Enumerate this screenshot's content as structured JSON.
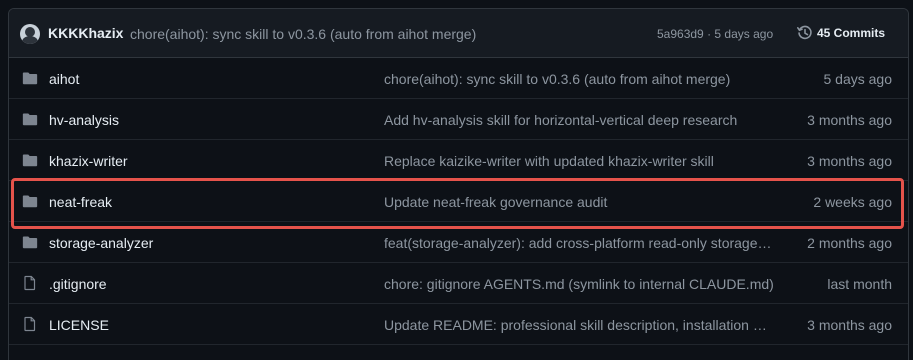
{
  "header": {
    "author": "KKKKhazix",
    "commit_message": "chore(aihot): sync skill to v0.3.6 (auto from aihot merge)",
    "commit_hash": "5a963d9",
    "separator": "·",
    "commit_time": "5 days ago",
    "commits_label": "45 Commits",
    "icons": {
      "avatar": "user-avatar",
      "history": "history-clock-icon"
    }
  },
  "rows": [
    {
      "type": "folder",
      "name": "aihot",
      "message": "chore(aihot): sync skill to v0.3.6 (auto from aihot merge)",
      "date": "5 days ago"
    },
    {
      "type": "folder",
      "name": "hv-analysis",
      "message": "Add hv-analysis skill for horizontal-vertical deep research",
      "date": "3 months ago"
    },
    {
      "type": "folder",
      "name": "khazix-writer",
      "message": "Replace kaizike-writer with updated khazix-writer skill",
      "date": "3 months ago"
    },
    {
      "type": "folder",
      "name": "neat-freak",
      "message": "Update neat-freak governance audit",
      "date": "2 weeks ago",
      "highlighted": true
    },
    {
      "type": "folder",
      "name": "storage-analyzer",
      "message": "feat(storage-analyzer): add cross-platform read-only storage analyzer",
      "date": "2 months ago"
    },
    {
      "type": "file",
      "name": ".gitignore",
      "message": "chore: gitignore AGENTS.md (symlink to internal CLAUDE.md)",
      "date": "last month"
    },
    {
      "type": "file",
      "name": "LICENSE",
      "message": "Update README: professional skill description, installation guide",
      "date": "3 months ago"
    }
  ],
  "colors": {
    "background": "#0d1117",
    "header_background": "#161b22",
    "border": "#30363d",
    "folder_icon": "#7d8590",
    "highlight_outline": "#e5534b"
  }
}
